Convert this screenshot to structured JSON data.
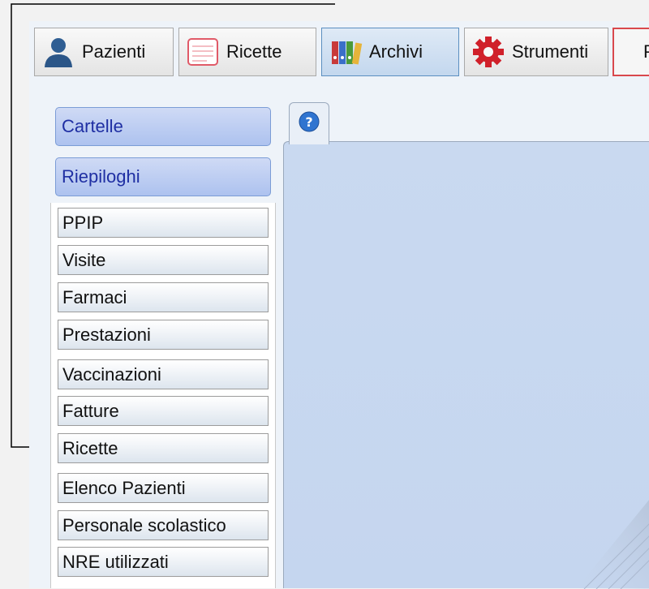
{
  "toolbar": {
    "buttons": [
      {
        "label": "Pazienti",
        "icon": "patient-icon"
      },
      {
        "label": "Ricette",
        "icon": "prescription-icon"
      },
      {
        "label": "Archivi",
        "icon": "binders-icon"
      },
      {
        "label": "Strumenti",
        "icon": "gear-icon"
      },
      {
        "label": "P",
        "icon": ""
      }
    ]
  },
  "sidebar": {
    "sections": [
      {
        "label": "Cartelle"
      },
      {
        "label": "Riepiloghi"
      }
    ],
    "items": [
      {
        "label": "PPIP"
      },
      {
        "label": "Visite"
      },
      {
        "label": "Farmaci"
      },
      {
        "label": "Prestazioni"
      },
      {
        "label": "Vaccinazioni"
      },
      {
        "label": "Fatture"
      },
      {
        "label": "Ricette"
      },
      {
        "label": "Elenco Pazienti"
      },
      {
        "label": "Personale scolastico"
      },
      {
        "label": "NRE utilizzati"
      }
    ]
  },
  "content": {
    "tab_icon": "help-icon"
  },
  "colors": {
    "accent": "#adc2ef",
    "accent_text": "#1f2fa3",
    "active_toolbar": "#c3d7ee",
    "danger_border": "#d9484d",
    "content_bg": "#c9d9f0"
  }
}
